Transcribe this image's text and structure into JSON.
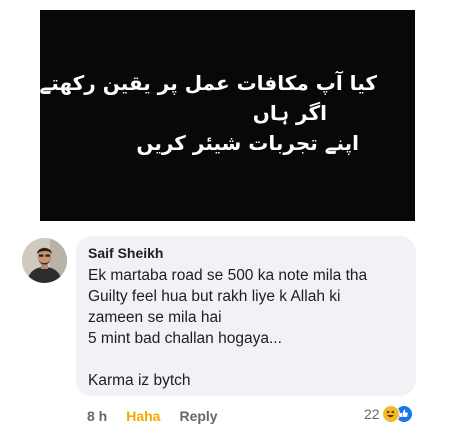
{
  "post": {
    "urdu_lines": [
      "کیا آپ مکافات عمل پر یقین رکھتے ہو؟",
      "اگر ہاں",
      "اپنے تجربات شیئر کریں"
    ]
  },
  "comment": {
    "author": "Saif Sheikh",
    "text": "Ek martaba road se 500 ka note mila tha\nGuilty feel hua but rakh liye k Allah ki\nzameen se mila hai\n5 mint bad challan hogaya...\n\nKarma iz bytch",
    "time": "8 h",
    "reaction_label": "Haha",
    "reply_label": "Reply",
    "reaction_count": "22",
    "reaction_icons": [
      "haha-icon",
      "like-icon"
    ]
  },
  "colors": {
    "post_background": "#080808",
    "bubble": "#f0f2f5",
    "haha_active": "#f5a700",
    "like": "#1877f2"
  }
}
